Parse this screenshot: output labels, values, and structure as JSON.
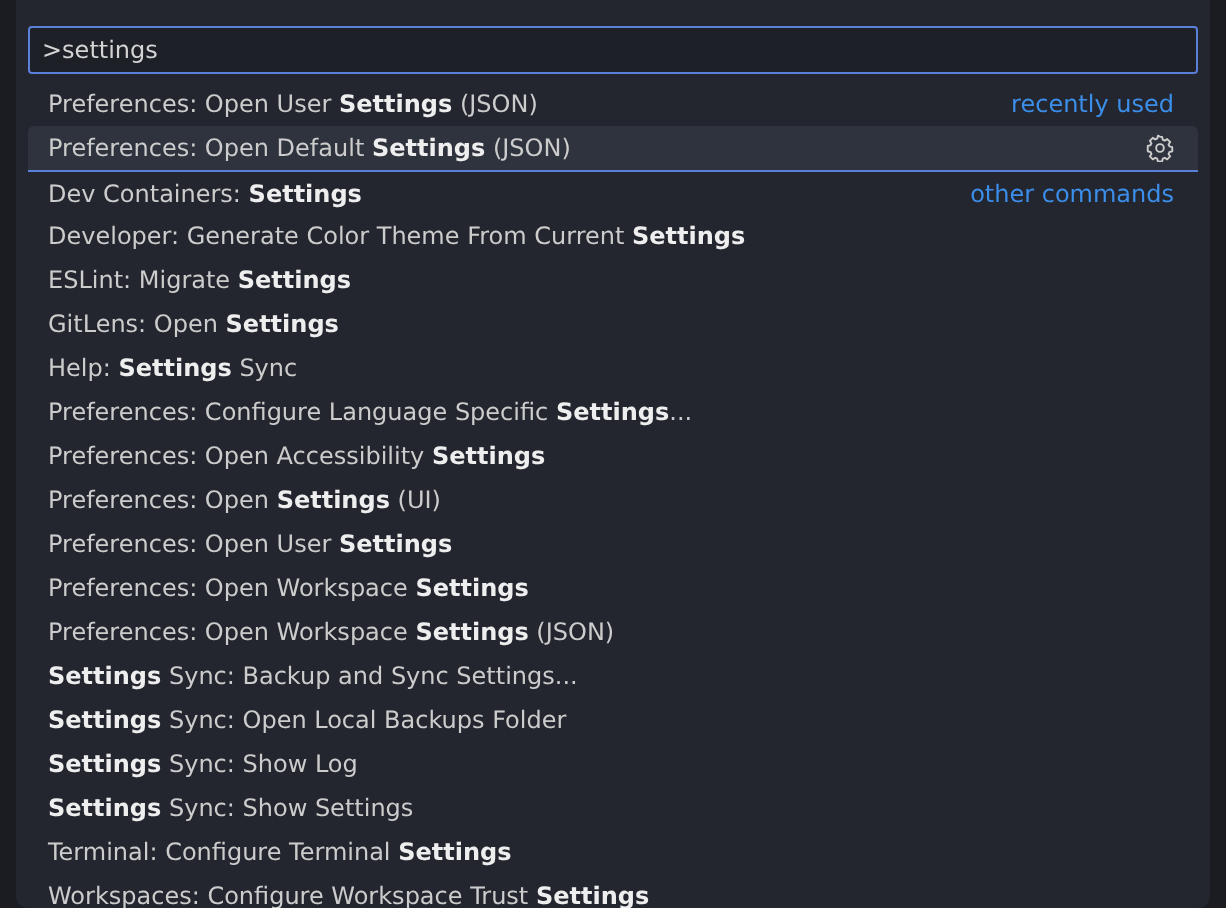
{
  "input": {
    "value": ">settings"
  },
  "items": [
    {
      "label": "Preferences: Open User **Settings** (JSON)",
      "group": "recently used",
      "selected": false
    },
    {
      "label": "Preferences: Open Default **Settings** (JSON)",
      "selected": true
    },
    {
      "label": "Dev Containers: **Settings**",
      "group": "other commands",
      "selected": false
    },
    {
      "label": "Developer: Generate Color Theme From Current **Settings**",
      "selected": false
    },
    {
      "label": "ESLint: Migrate **Settings**",
      "selected": false
    },
    {
      "label": "GitLens: Open **Settings**",
      "selected": false
    },
    {
      "label": "Help: **Settings** Sync",
      "selected": false
    },
    {
      "label": "Preferences: Configure Language Specific **Settings**...",
      "selected": false
    },
    {
      "label": "Preferences: Open Accessibility **Settings**",
      "selected": false
    },
    {
      "label": "Preferences: Open **Settings** (UI)",
      "selected": false
    },
    {
      "label": "Preferences: Open User **Settings**",
      "selected": false
    },
    {
      "label": "Preferences: Open Workspace **Settings**",
      "selected": false
    },
    {
      "label": "Preferences: Open Workspace **Settings** (JSON)",
      "selected": false
    },
    {
      "label": "**Settings** Sync: Backup and Sync Settings...",
      "selected": false
    },
    {
      "label": "**Settings** Sync: Open Local Backups Folder",
      "selected": false
    },
    {
      "label": "**Settings** Sync: Show Log",
      "selected": false
    },
    {
      "label": "**Settings** Sync: Show Settings",
      "selected": false
    },
    {
      "label": "Terminal: Configure Terminal **Settings**",
      "selected": false
    },
    {
      "label": "Workspaces: Configure Workspace Trust **Settings**",
      "selected": false
    }
  ]
}
